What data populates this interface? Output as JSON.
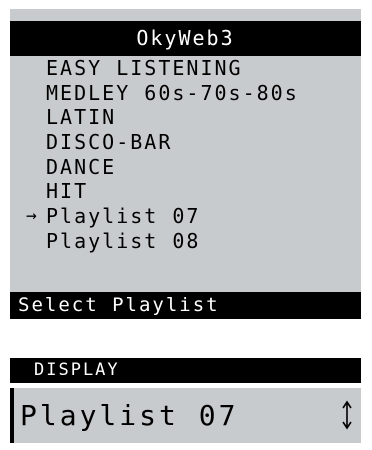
{
  "screen": {
    "title": "OkyWeb3",
    "menu_items": [
      {
        "label": "EASY LISTENING",
        "selected": false
      },
      {
        "label": "MEDLEY 60s-70s-80s",
        "selected": false
      },
      {
        "label": "LATIN",
        "selected": false
      },
      {
        "label": "DISCO-BAR",
        "selected": false
      },
      {
        "label": "DANCE",
        "selected": false
      },
      {
        "label": "HIT",
        "selected": false
      },
      {
        "label": "Playlist 07",
        "selected": true
      },
      {
        "label": "Playlist 08",
        "selected": false
      }
    ],
    "selection_arrow": "→",
    "status": "Select Playlist"
  },
  "display": {
    "label": "DISPLAY",
    "value": "Playlist 07",
    "icon": "up-down-arrow-icon"
  },
  "colors": {
    "lcd_background": "#c8cbcd",
    "bar_background": "#000000",
    "bar_text": "#ffffff",
    "lcd_text": "#000000"
  }
}
